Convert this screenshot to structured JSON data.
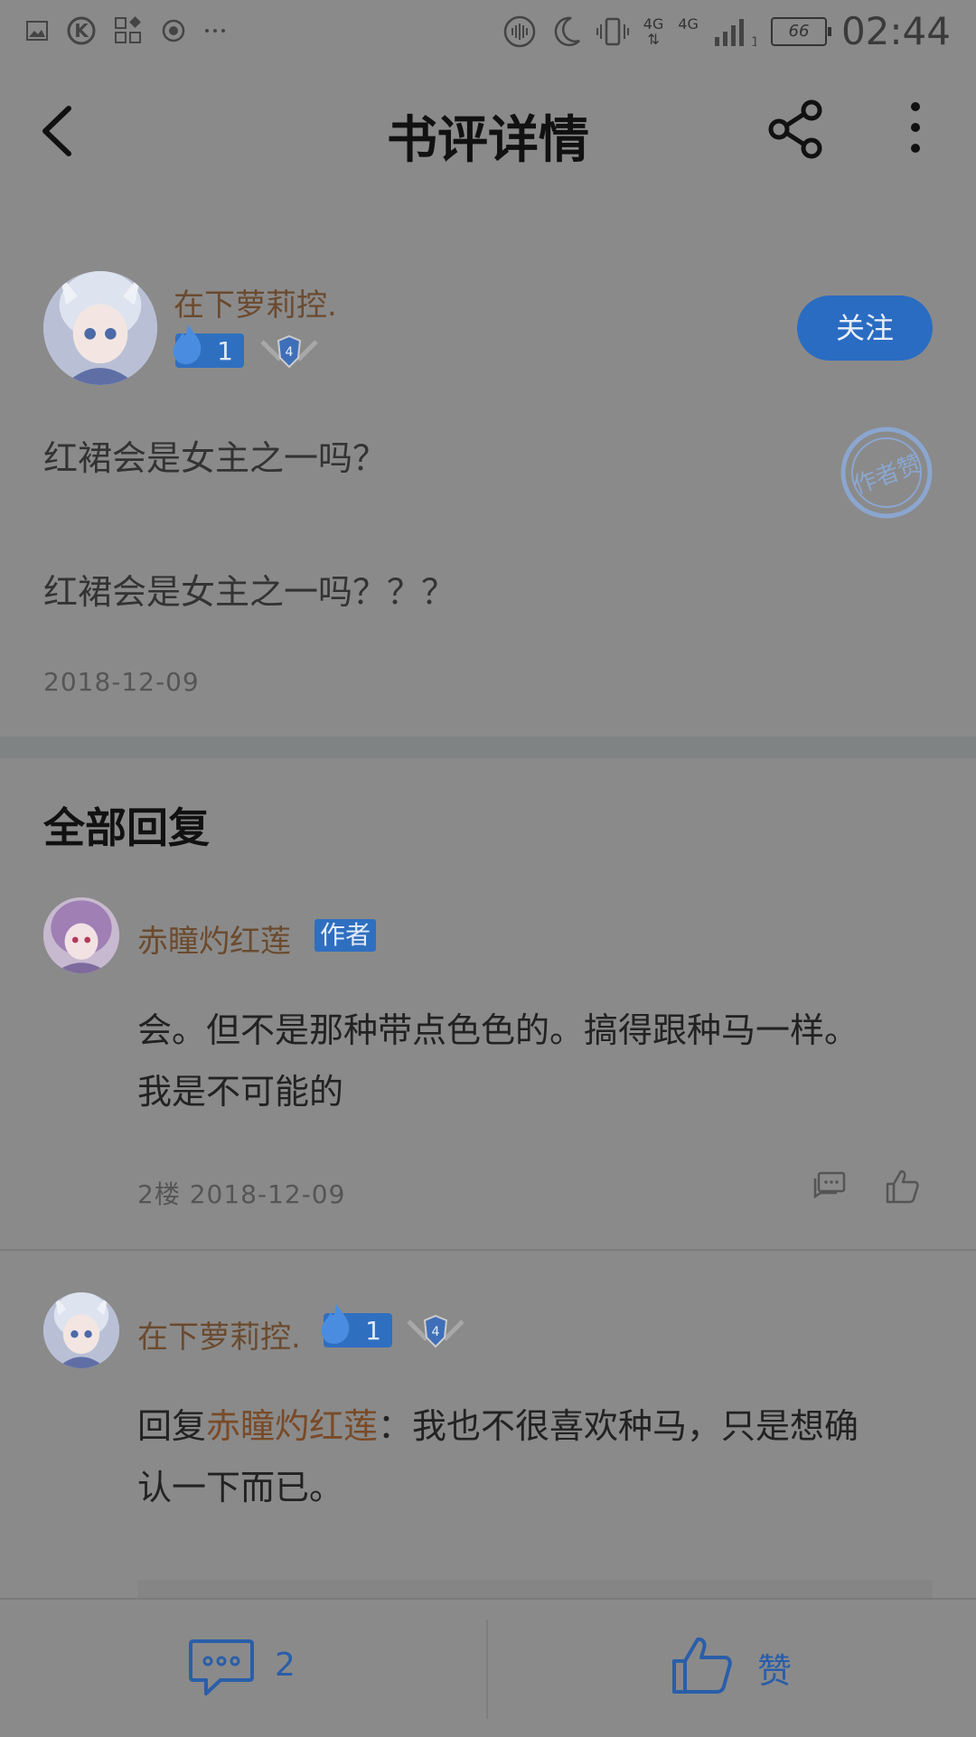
{
  "status_bar": {
    "time": "02:44",
    "battery": "66",
    "network_1": "4G",
    "network_2": "4G",
    "signal_sub": "1",
    "icons": [
      "image-icon",
      "k-icon",
      "apps-icon",
      "record-icon",
      "more-dots-icon",
      "vibrate-icon",
      "moon-icon",
      "phone-vibrate-icon",
      "signal-icon",
      "battery-icon"
    ]
  },
  "header": {
    "title": "书评详情",
    "icons": [
      "back-arrow-icon",
      "share-icon",
      "more-vertical-icon"
    ]
  },
  "post": {
    "author": "在下萝莉控.",
    "level": "1",
    "shield_level": "4",
    "follow_label": "关注",
    "title": "红裙会是女主之一吗？",
    "body": "红裙会是女主之一吗？？？",
    "date": "2018-12-09",
    "stamp_text": "作者赞"
  },
  "replies_section": {
    "title": "全部回复"
  },
  "replies": [
    {
      "name": "赤瞳灼红莲",
      "tag": "作者",
      "text_line1": "会。但不是那种带点色色的。搞得跟种马一样。",
      "text_line2": "我是不可能的",
      "floor_date": "2楼 2018-12-09"
    },
    {
      "name": "在下萝莉控.",
      "level": "1",
      "shield_level": "4",
      "reply_prefix": "回复",
      "mention": "赤瞳灼红莲",
      "text_after_mention": "：我也不很喜欢种马，只是想确",
      "text_line2": "认一下而已。"
    }
  ],
  "bottom_bar": {
    "comment_count": "2",
    "like_label": "赞"
  },
  "colors": {
    "accent_blue": "#2a6cc2",
    "name_brown": "#6b4a2e",
    "overlay_gray": "#8a8a8a"
  }
}
